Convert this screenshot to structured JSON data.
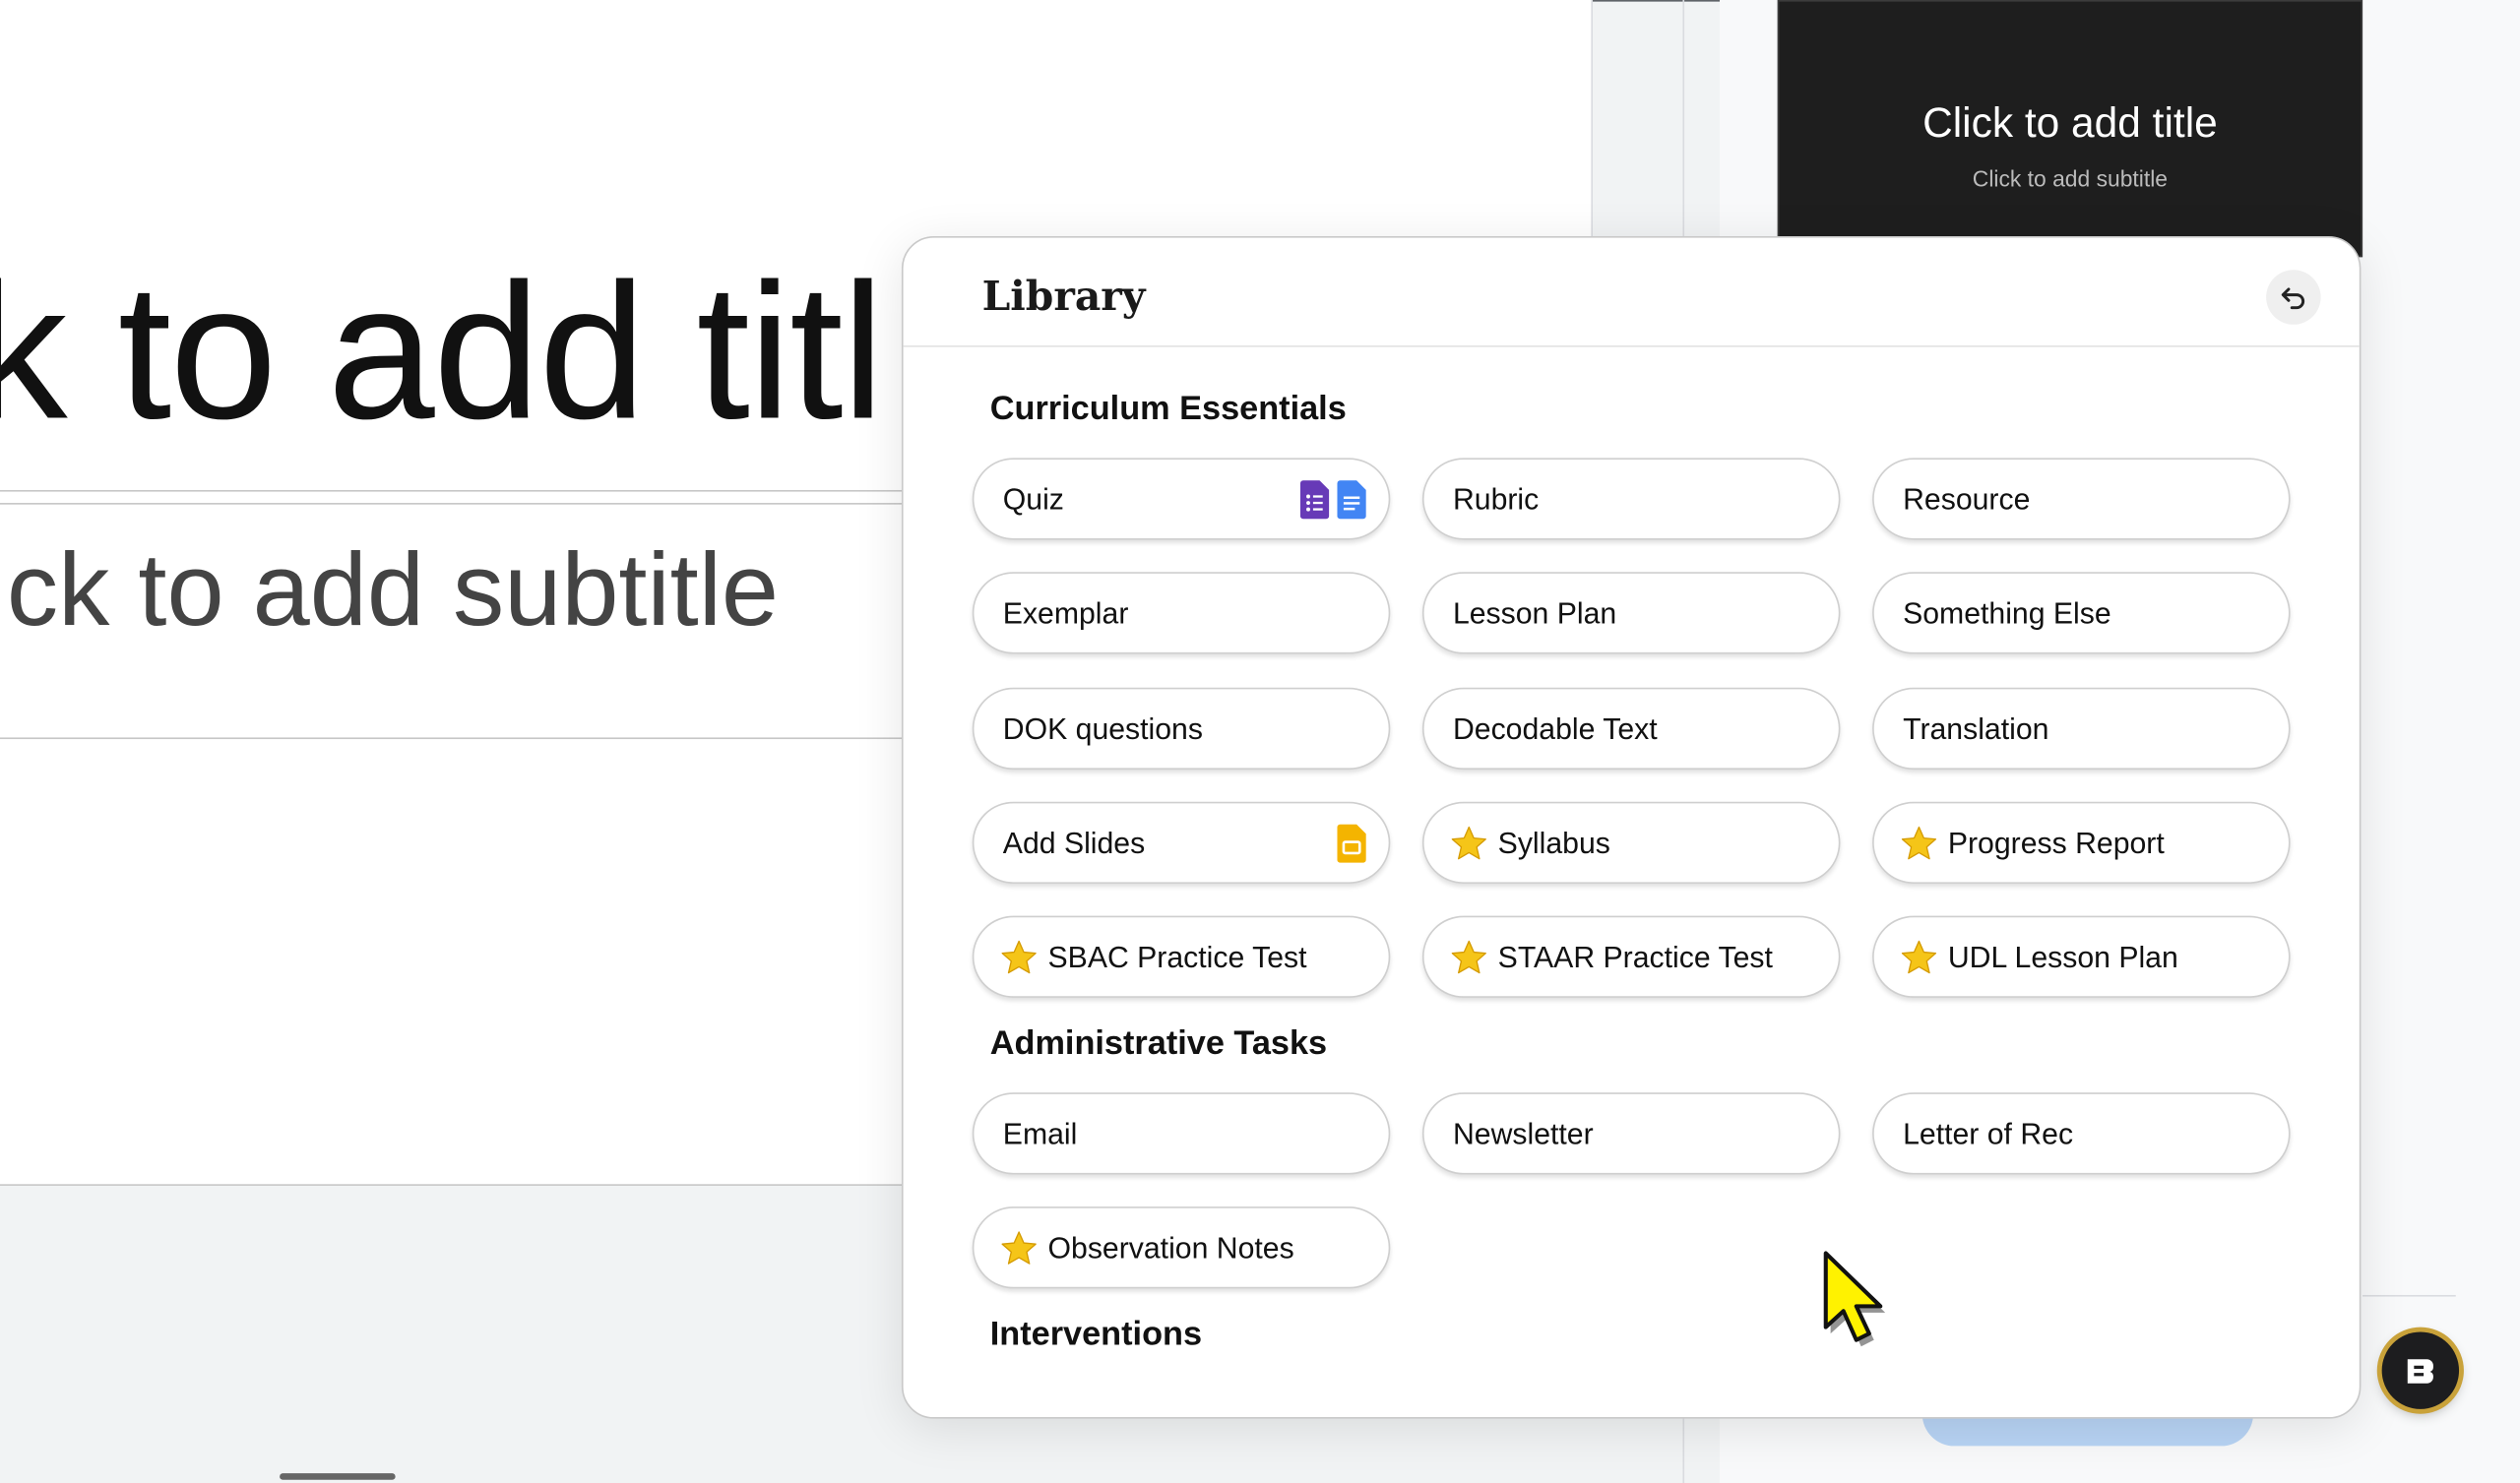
{
  "slide": {
    "title_text": "k to add titl",
    "subtitle_text": "ick to add subtitle"
  },
  "thumbnail": {
    "title": "Click to add title",
    "subtitle": "Click to add subtitle"
  },
  "library": {
    "title": "Library",
    "sections": [
      {
        "title": "Curriculum Essentials",
        "items": [
          "Quiz",
          "Rubric",
          "Resource",
          "Exemplar",
          "Lesson Plan",
          "Something Else",
          "DOK questions",
          "Decodable Text",
          "Translation",
          "Add Slides",
          "Syllabus",
          "Progress Report",
          "SBAC Practice Test",
          "STAAR Practice Test",
          "UDL Lesson Plan"
        ]
      },
      {
        "title": "Administrative Tasks",
        "items": [
          "Email",
          "Newsletter",
          "Letter of Rec",
          "Observation Notes"
        ]
      },
      {
        "title": "Interventions",
        "items": []
      }
    ]
  },
  "icons": {
    "back": "undo-arrow-icon",
    "star": "star-icon",
    "forms": "google-forms-icon",
    "docs": "google-docs-icon",
    "slides": "google-slides-icon",
    "cursor": "mouse-pointer-icon",
    "fab": "assistant-logo-icon"
  },
  "colors": {
    "star": "#f5c518",
    "forms": "#673ab7",
    "docs": "#4285f4",
    "slides": "#f4b400",
    "cursor": "#fff200"
  }
}
